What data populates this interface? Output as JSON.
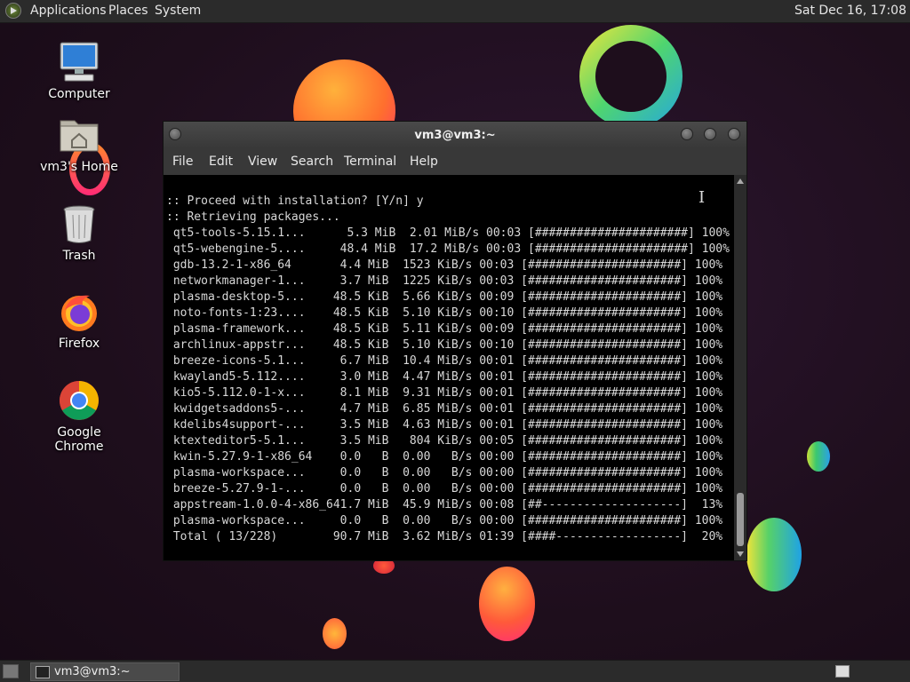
{
  "top_panel": {
    "menus": [
      "Applications",
      "Places",
      "System"
    ],
    "clock": "Sat Dec 16, 17:08"
  },
  "desktop_icons": [
    "Computer",
    "vm3's Home",
    "Trash",
    "Firefox",
    "Google Chrome"
  ],
  "terminal": {
    "title": "vm3@vm3:~",
    "menu": [
      "File",
      "Edit",
      "View",
      "Search",
      "Terminal",
      "Help"
    ],
    "output": ":: Proceed with installation? [Y/n] y\n:: Retrieving packages...\n qt5-tools-5.15.1...      5.3 MiB  2.01 MiB/s 00:03 [######################] 100%\n qt5-webengine-5....     48.4 MiB  17.2 MiB/s 00:03 [######################] 100%\n gdb-13.2-1-x86_64       4.4 MiB  1523 KiB/s 00:03 [######################] 100%\n networkmanager-1...     3.7 MiB  1225 KiB/s 00:03 [######################] 100%\n plasma-desktop-5...    48.5 KiB  5.66 KiB/s 00:09 [######################] 100%\n noto-fonts-1:23....    48.5 KiB  5.10 KiB/s 00:10 [######################] 100%\n plasma-framework...    48.5 KiB  5.11 KiB/s 00:09 [######################] 100%\n archlinux-appstr...    48.5 KiB  5.10 KiB/s 00:10 [######################] 100%\n breeze-icons-5.1...     6.7 MiB  10.4 MiB/s 00:01 [######################] 100%\n kwayland5-5.112....     3.0 MiB  4.47 MiB/s 00:01 [######################] 100%\n kio5-5.112.0-1-x...     8.1 MiB  9.31 MiB/s 00:01 [######################] 100%\n kwidgetsaddons5-...     4.7 MiB  6.85 MiB/s 00:01 [######################] 100%\n kdelibs4support-...     3.5 MiB  4.63 MiB/s 00:01 [######################] 100%\n ktexteditor5-5.1...     3.5 MiB   804 KiB/s 00:05 [######################] 100%\n kwin-5.27.9-1-x86_64    0.0   B  0.00   B/s 00:00 [######################] 100%\n plasma-workspace...     0.0   B  0.00   B/s 00:00 [######################] 100%\n breeze-5.27.9-1-...     0.0   B  0.00   B/s 00:00 [######################] 100%\n appstream-1.0.0-4-x86_641.7 MiB  45.9 MiB/s 00:08 [##--------------------]  13%\n plasma-workspace...     0.0   B  0.00   B/s 00:00 [######################] 100%\n Total ( 13/228)        90.7 MiB  3.62 MiB/s 01:39 [####------------------]  20%"
  },
  "taskbar": {
    "window_label": "vm3@vm3:~"
  },
  "colors": {
    "panel": "#2b2b2b",
    "terminal_bg": "#000000",
    "terminal_fg": "#d8d8d8"
  }
}
